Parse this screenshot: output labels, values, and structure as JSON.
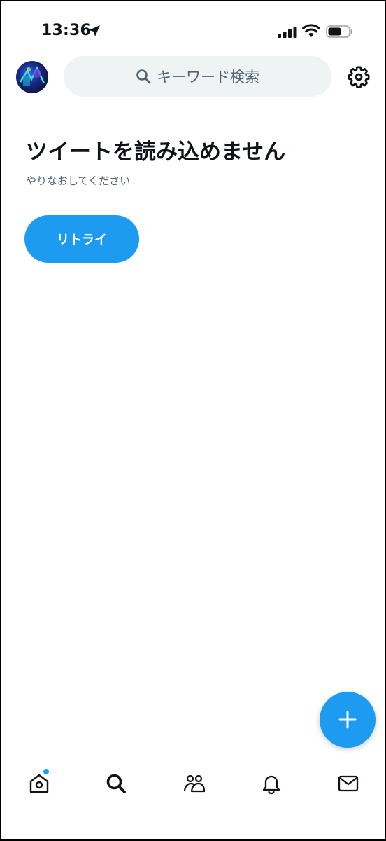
{
  "status_bar": {
    "time": "13:36",
    "battery_level": 0.65
  },
  "header": {
    "search_placeholder": "キーワード検索"
  },
  "main": {
    "error_title": "ツイートを読み込めません",
    "error_subtitle": "やりなおしてください",
    "retry_label": "リトライ"
  },
  "bottom_nav": {
    "items": [
      "home-icon",
      "search-icon",
      "communities-icon",
      "notifications-icon",
      "messages-icon"
    ],
    "active": "search",
    "home_has_notification": true
  },
  "colors": {
    "accent": "#1d9bf0",
    "text_primary": "#0f1419",
    "text_secondary": "#536471",
    "search_bg": "#eff3f4"
  }
}
